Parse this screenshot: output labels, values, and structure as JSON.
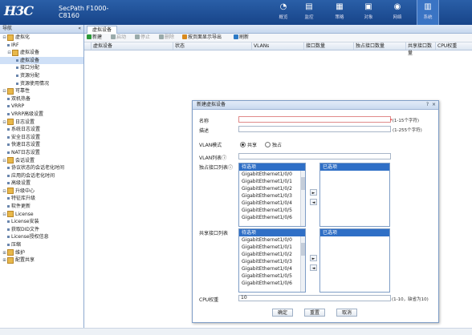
{
  "header": {
    "logo": "H3C",
    "model": "SecPath F1000-C8160",
    "icons": [
      {
        "label": "概览",
        "icon": "dashboard-icon",
        "glyph": "◔"
      },
      {
        "label": "监控",
        "icon": "monitor-icon",
        "glyph": "▤"
      },
      {
        "label": "策略",
        "icon": "policy-icon",
        "glyph": "▦"
      },
      {
        "label": "对象",
        "icon": "object-icon",
        "glyph": "▣"
      },
      {
        "label": "网络",
        "icon": "network-icon",
        "glyph": "◉"
      },
      {
        "label": "系统",
        "icon": "system-icon",
        "glyph": "▥"
      }
    ]
  },
  "sidebar": {
    "title": "导航",
    "collapse": "«",
    "items": [
      {
        "label": "虚拟化",
        "level": 0,
        "exp": "⊟",
        "folder": true
      },
      {
        "label": "IRF",
        "level": 1
      },
      {
        "label": "虚拟设备",
        "level": 1,
        "exp": "⊟",
        "folder": true
      },
      {
        "label": "虚拟设备",
        "level": 2,
        "selected": true
      },
      {
        "label": "接口分配",
        "level": 2
      },
      {
        "label": "资源分配",
        "level": 2
      },
      {
        "label": "资源使用情况",
        "level": 2
      },
      {
        "label": "可靠性",
        "level": 0,
        "exp": "⊟",
        "folder": true
      },
      {
        "label": "双机热备",
        "level": 1
      },
      {
        "label": "VRRP",
        "level": 1
      },
      {
        "label": "VRRP高级设置",
        "level": 1
      },
      {
        "label": "日志设置",
        "level": 0,
        "exp": "⊟",
        "folder": true
      },
      {
        "label": "系统日志设置",
        "level": 1
      },
      {
        "label": "安全日志设置",
        "level": 1
      },
      {
        "label": "快速日志设置",
        "level": 1
      },
      {
        "label": "NAT日志设置",
        "level": 1
      },
      {
        "label": "会话设置",
        "level": 0,
        "exp": "⊟",
        "folder": true
      },
      {
        "label": "协议状态的会话老化时间",
        "level": 1
      },
      {
        "label": "应用的会话老化时间",
        "level": 1
      },
      {
        "label": "高级设置",
        "level": 1
      },
      {
        "label": "升级中心",
        "level": 0,
        "exp": "⊟",
        "folder": true
      },
      {
        "label": "特征库升级",
        "level": 1
      },
      {
        "label": "软件更新",
        "level": 1
      },
      {
        "label": "License",
        "level": 0,
        "exp": "⊟",
        "folder": true
      },
      {
        "label": "License安装",
        "level": 1
      },
      {
        "label": "获取DID文件",
        "level": 1
      },
      {
        "label": "License授权信息",
        "level": 1
      },
      {
        "label": "压缩",
        "level": 1
      },
      {
        "label": "维护",
        "level": 0,
        "exp": "⊞",
        "folder": true
      },
      {
        "label": "配置共享",
        "level": 0,
        "exp": "⊞",
        "folder": true
      }
    ]
  },
  "main": {
    "tab": "虚拟设备",
    "toolbar": [
      {
        "label": "新建",
        "disabled": false,
        "icon": "add-icon",
        "color": "#2c9a3a"
      },
      {
        "label": "启动",
        "disabled": true,
        "icon": "start-icon",
        "color": "#9aa"
      },
      {
        "label": "停止",
        "disabled": true,
        "icon": "stop-icon",
        "color": "#9aa"
      },
      {
        "label": "删除",
        "disabled": true,
        "icon": "delete-icon",
        "color": "#9aa"
      },
      {
        "label": "按页面显示导出",
        "disabled": false,
        "icon": "export-icon",
        "color": "#d88a1e"
      },
      {
        "label": "刷新",
        "disabled": false,
        "icon": "refresh-icon",
        "color": "#2c7ac6"
      }
    ],
    "columns": [
      "虚拟设备",
      "状态",
      "VLANs",
      "接口数量",
      "独占接口数量",
      "共享接口数量",
      "CPU权重"
    ]
  },
  "dialog": {
    "title": "新建虚拟设备",
    "help": "?",
    "close": "×",
    "name_label": "名称",
    "name_hint": "(1-15个字符)",
    "desc_label": "描述",
    "desc_hint": "(1-255个字符)",
    "vlan_mode_label": "VLAN模式",
    "vlan_mode_shared": "共享",
    "vlan_mode_exclusive": "独占",
    "vlan_list_label": "VLAN列表",
    "exclusive_ports_label": "独占接口列表",
    "shared_ports_label": "共享接口列表",
    "available_header": "待选项",
    "selected_header": "已选项",
    "exclusive_ports": [
      "GigabitEthernet1/0/0",
      "GigabitEthernet1/0/1",
      "GigabitEthernet1/0/2",
      "GigabitEthernet1/0/3",
      "GigabitEthernet1/0/4",
      "GigabitEthernet1/0/5",
      "GigabitEthernet1/0/6"
    ],
    "shared_ports": [
      "GigabitEthernet1/0/0",
      "GigabitEthernet1/0/1",
      "GigabitEthernet1/0/2",
      "GigabitEthernet1/0/3",
      "GigabitEthernet1/0/4",
      "GigabitEthernet1/0/5",
      "GigabitEthernet1/0/6"
    ],
    "cpu_label": "CPU权重",
    "cpu_value": "10",
    "cpu_hint": "(1-10，缺省为10)",
    "ok": "确定",
    "reset": "重置",
    "cancel": "取消"
  }
}
